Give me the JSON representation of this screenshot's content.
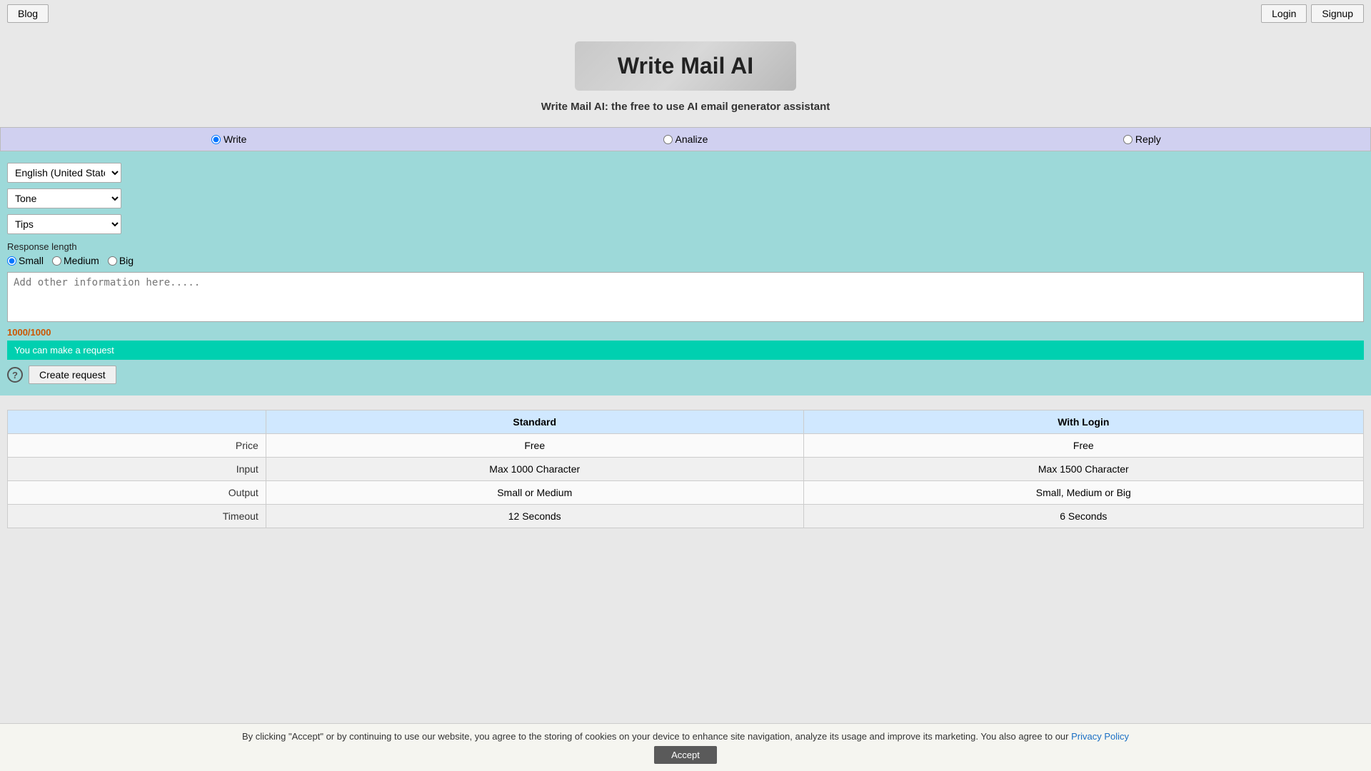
{
  "header": {
    "blog_label": "Blog",
    "login_label": "Login",
    "signup_label": "Signup"
  },
  "title": {
    "main": "Write Mail AI",
    "subtitle": "Write Mail AI: the free to use AI email generator assistant"
  },
  "mode_selector": {
    "options": [
      {
        "id": "write",
        "label": "Write",
        "checked": true
      },
      {
        "id": "analize",
        "label": "Analize",
        "checked": false
      },
      {
        "id": "reply",
        "label": "Reply",
        "checked": false
      }
    ]
  },
  "form": {
    "language_default": "English (United States)",
    "tone_default": "Tone",
    "tips_default": "Tips",
    "response_length_label": "Response length",
    "response_options": [
      {
        "id": "small",
        "label": "Small",
        "checked": true
      },
      {
        "id": "medium",
        "label": "Medium",
        "checked": false
      },
      {
        "id": "big",
        "label": "Big",
        "checked": false
      }
    ],
    "additional_info_placeholder": "Add other information here.....",
    "char_count": "1000/1000",
    "request_status": "You can make a request",
    "help_icon": "?",
    "create_request_label": "Create request"
  },
  "pricing": {
    "columns": [
      "",
      "Standard",
      "With Login"
    ],
    "rows": [
      {
        "label": "Price",
        "standard": "Free",
        "login": "Free"
      },
      {
        "label": "Input",
        "standard": "Max 1000 Character",
        "login": "Max 1500 Character"
      },
      {
        "label": "Output",
        "standard": "Small or Medium",
        "login": "Small, Medium or Big"
      },
      {
        "label": "Timeout",
        "standard": "12 Seconds",
        "login": "6 Seconds"
      }
    ]
  },
  "cookie": {
    "text": "By clicking \"Accept\" or by continuing to use our website, you agree to the storing of cookies on your device to enhance site navigation, analyze its usage and improve its marketing. You also agree to our",
    "privacy_policy_label": "Privacy Policy",
    "accept_label": "Accept"
  }
}
